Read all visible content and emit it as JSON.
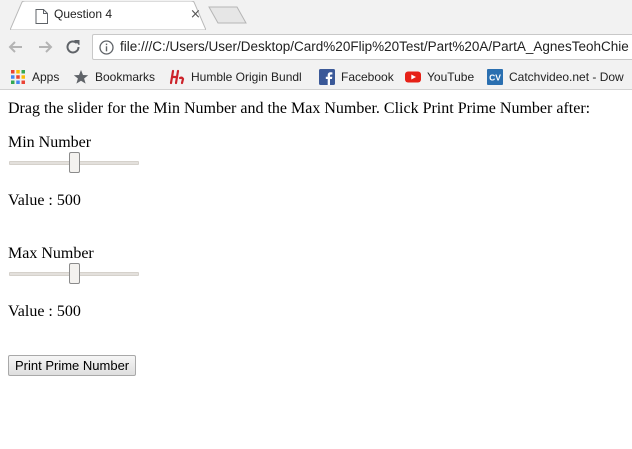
{
  "tab": {
    "title": "Question 4",
    "close_glyph": "×"
  },
  "toolbar": {
    "url": "file:///C:/Users/User/Desktop/Card%20Flip%20Test/Part%20A/PartA_AgnesTeohChie"
  },
  "bookmarks": [
    {
      "label": "Apps",
      "icon": "apps-grid-icon"
    },
    {
      "label": "Bookmarks",
      "icon": "star-icon"
    },
    {
      "label": "Humble Origin Bundl",
      "icon": "humble-icon"
    },
    {
      "label": "Facebook",
      "icon": "facebook-icon"
    },
    {
      "label": "YouTube",
      "icon": "youtube-icon"
    },
    {
      "label": "Catchvideo.net - Dow",
      "icon": "catchvideo-icon"
    }
  ],
  "page": {
    "instructions": "Drag the slider for the Min Number and the Max Number. Click Print Prime Number after:",
    "min": {
      "label": "Min Number",
      "value_text": "Value : 500",
      "slider_value": 500,
      "slider_fraction": 0.5
    },
    "max": {
      "label": "Max Number",
      "value_text": "Value : 500",
      "slider_value": 500,
      "slider_fraction": 0.5
    },
    "print_button": "Print Prime Number"
  },
  "colors": {
    "chrome_bg": "#f2f2f2",
    "facebook_blue": "#3b5998",
    "youtube_red": "#e62117",
    "catchvideo_blue": "#2a6fb0",
    "humble_red": "#cc2229"
  }
}
